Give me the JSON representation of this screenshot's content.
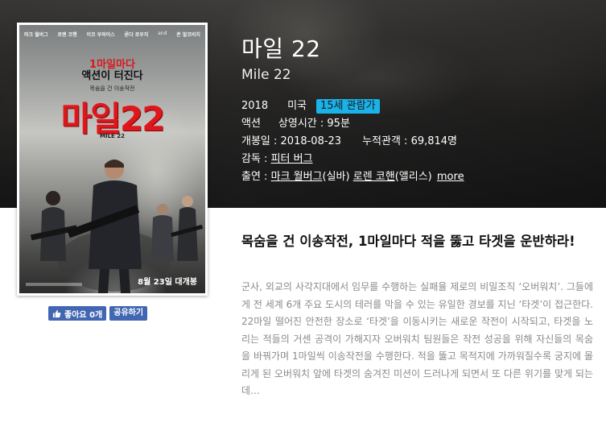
{
  "movie": {
    "title": "마일 22",
    "english_title": "Mile 22",
    "year": "2018",
    "country": "미국",
    "rating": "15세 관람가",
    "genre": "액션",
    "runtime_label": "상영시간 : 95분",
    "release_label": "개봉일 : 2018-08-23",
    "audience_label": "누적관객 : 69,814명",
    "director_prefix": "감독 : ",
    "director": "피터 버그",
    "cast_prefix": "출연 : ",
    "cast": [
      {
        "name": "마크 월버그",
        "role": "(실바)"
      },
      {
        "name": "로렌 코핸",
        "role": "(앨리스)"
      }
    ],
    "more_label": "more"
  },
  "poster": {
    "cast_names": [
      "마크 월버그",
      "로렌 코핸",
      "이코 우와이스",
      "론다 로우지",
      "and",
      "존 말코비치"
    ],
    "tagline_red": "1마일마다",
    "tagline_black": "액션이 터진다",
    "subtitle": "목숨을 건 이송작전",
    "title": "마일22",
    "english_title": "MILE 22",
    "release": "8월 23일 대개봉"
  },
  "social": {
    "like_label": "좋아요 0개",
    "share_label": "공유하기"
  },
  "content": {
    "tagline": "목숨을 건 이송작전, 1마일마다 적을 뚫고 타겟을 운반하라!",
    "synopsis": "군사, 외교의 사각지대에서 임무를 수행하는 실패율 제로의 비밀조직 ‘오버워치’. 그들에게 전 세계 6개 주요 도시의 테러를 막을 수 있는 유일한 경보를 지닌 ‘타겟’이 접근한다. 22마일 떨어진 안전한 장소로 ‘타겟’을 이동시키는 새로운 작전이 시작되고, 타겟을 노리는 적들의 거센 공격이 가해지자 오버워치 팀원들은 작전 성공을 위해 자신들의 목숨을 바꿔가며 1마일씩 이송작전을 수행한다. 적을 뚫고 목적지에 가까워질수록 궁지에 몰리게 된 오버워치 앞에 타겟의 숨겨진 미션이 드러나게 되면서 또 다른 위기를 맞게 되는데…"
  },
  "colors": {
    "rating_badge": "#1ab2e8",
    "facebook_blue": "#4267b2",
    "poster_red": "#e0161c"
  }
}
